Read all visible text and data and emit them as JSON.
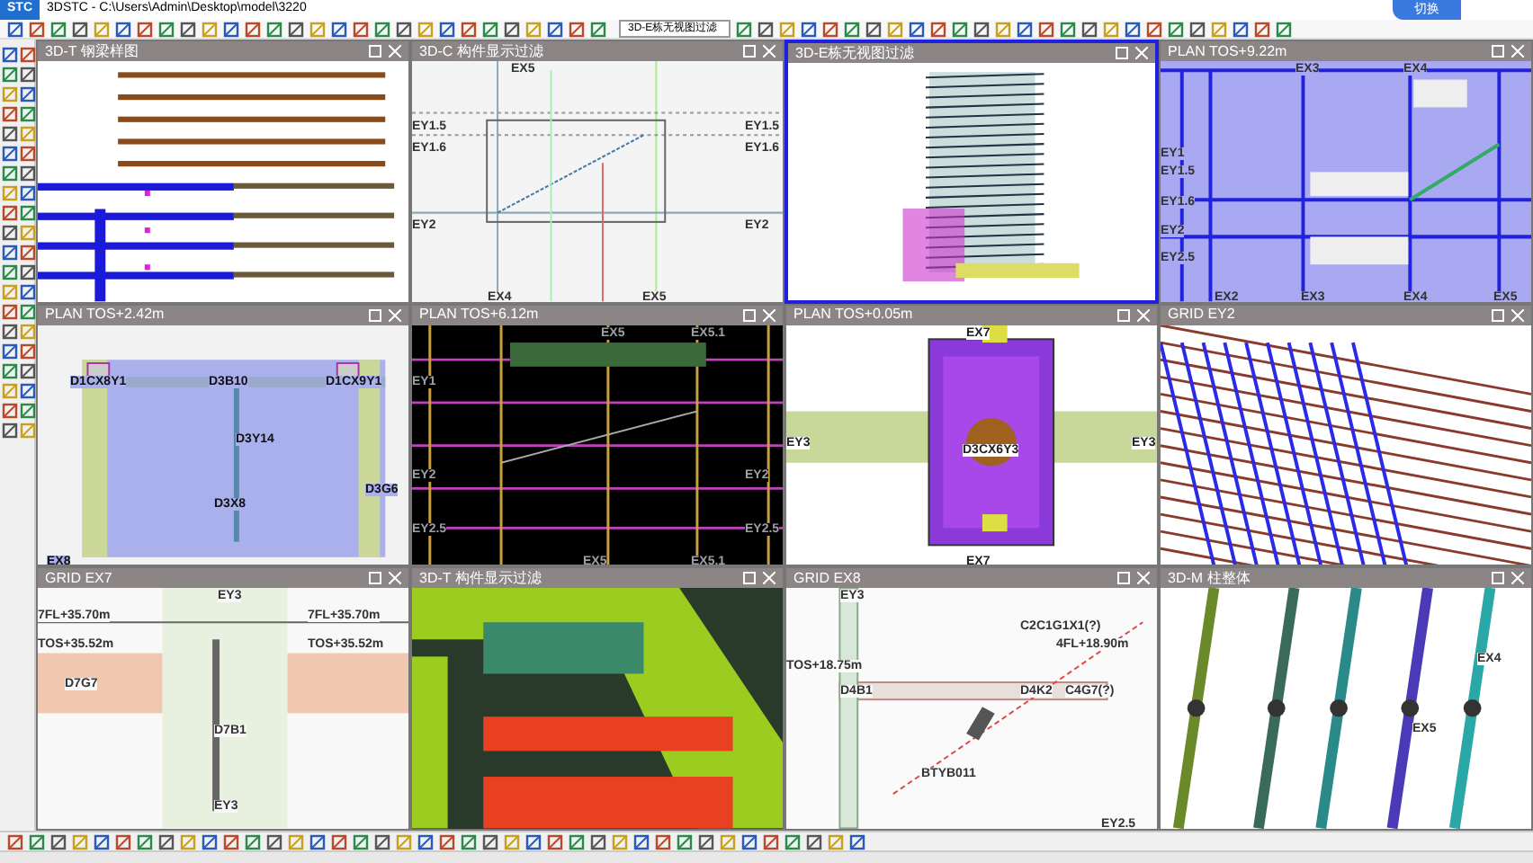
{
  "window": {
    "logo": "STC",
    "title": "3DSTC - C:\\Users\\Admin\\Desktop\\model\\3220",
    "badge": "切换"
  },
  "toolbar": {
    "view_select": "3D-E栋无视图过滤"
  },
  "viewports": [
    {
      "title": "3D-T 钢梁样图",
      "kind": "beams",
      "selected": false
    },
    {
      "title": "3D-C 构件显示过滤",
      "kind": "filter",
      "selected": false,
      "labels": [
        "EX5",
        "EY1.5",
        "EY1.6",
        "EY2",
        "EY1.5",
        "EY1.6",
        "EY2",
        "EX4",
        "EX5"
      ]
    },
    {
      "title": "3D-E栋无视图过滤",
      "kind": "tower",
      "selected": true
    },
    {
      "title": "PLAN TOS+9.22m",
      "kind": "plan",
      "selected": false,
      "labels": [
        "EX3",
        "EX4",
        "EY1",
        "EY1.5",
        "EY1.6",
        "EY2",
        "EY2.5",
        "EX2",
        "EX3",
        "EX4",
        "EX5"
      ]
    },
    {
      "title": "PLAN TOS+2.42m",
      "kind": "planlight",
      "selected": false,
      "labels": [
        "D1CX8Y1",
        "D3B10",
        "D1CX9Y1",
        "D3Y14",
        "D3X8",
        "D3G6",
        "EX8"
      ]
    },
    {
      "title": "PLAN TOS+6.12m",
      "kind": "plandark",
      "selected": false,
      "labels": [
        "EX5",
        "EX5.1",
        "EY1",
        "EY2",
        "EY2.5",
        "EY2",
        "EY2.5",
        "EX5",
        "EX5.1"
      ]
    },
    {
      "title": "PLAN TOS+0.05m",
      "kind": "section",
      "selected": false,
      "labels": [
        "EX7",
        "EY3",
        "EY3",
        "D3CX6Y3",
        "EX7"
      ]
    },
    {
      "title": "GRID EY2",
      "kind": "grid3d",
      "selected": false
    },
    {
      "title": "GRID EX7",
      "kind": "elevation",
      "selected": false,
      "labels": [
        "EY3",
        "7FL+35.70m",
        "TOS+35.52m",
        "D7G7",
        "D7B1",
        "EY3",
        "7FL+35.70m",
        "TOS+35.52m"
      ]
    },
    {
      "title": "3D-T 构件显示过滤",
      "kind": "closeup",
      "selected": false
    },
    {
      "title": "GRID EX8",
      "kind": "detail",
      "selected": false,
      "labels": [
        "EY3",
        "C2C1G1X1(?)",
        "4FL+18.90m",
        "TOS+18.75m",
        "D4B1",
        "D4K2",
        "C4G7(?)",
        "BTYB011",
        "EY2.5"
      ]
    },
    {
      "title": "3D-M 柱整体",
      "kind": "columns",
      "selected": false,
      "labels": [
        "EX4",
        "EX5"
      ]
    }
  ]
}
